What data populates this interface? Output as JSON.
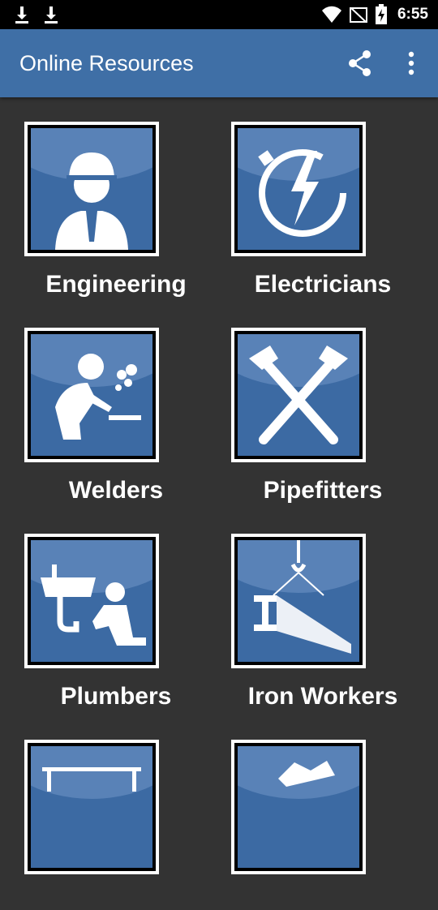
{
  "status_bar": {
    "time": "6:55",
    "icons": [
      "download-icon",
      "download-icon",
      "wifi-icon",
      "no-signal-icon",
      "battery-charging-icon"
    ]
  },
  "app_bar": {
    "title": "Online Resources",
    "actions": [
      "share-icon",
      "more-vert-icon"
    ]
  },
  "colors": {
    "app_bar": "#3f6fa6",
    "background": "#333333",
    "tile_blue": "#3c6aa3"
  },
  "grid": {
    "items": [
      {
        "label": "Engineering",
        "icon": "engineer-icon"
      },
      {
        "label": "Electricians",
        "icon": "electric-plug-bolt-icon"
      },
      {
        "label": "Welders",
        "icon": "welder-icon"
      },
      {
        "label": "Pipefitters",
        "icon": "pipe-wrenches-icon"
      },
      {
        "label": "Plumbers",
        "icon": "plumber-icon"
      },
      {
        "label": "Iron Workers",
        "icon": "steel-beam-crane-icon"
      },
      {
        "label": "",
        "icon": "partial-tile-icon"
      },
      {
        "label": "",
        "icon": "partial-tile-icon"
      }
    ]
  }
}
